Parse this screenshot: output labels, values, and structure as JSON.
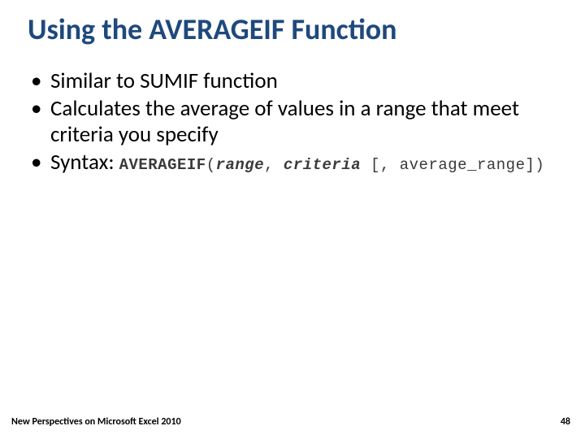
{
  "title": "Using the AVERAGEIF Function",
  "bullets": {
    "b1": "Similar to SUMIF function",
    "b2": "Calculates the average of values in a range that meet criteria you specify",
    "b3_label": "Syntax:"
  },
  "syntax": {
    "fn": "AVERAGEIF",
    "open": "(",
    "arg1": "range",
    "comma1": ", ",
    "arg2": "criteria",
    "opt_open": " [, ",
    "arg3": "average_range",
    "opt_close": "]",
    "close": ")"
  },
  "footer": {
    "left": "New Perspectives on Microsoft Excel 2010",
    "page": "48"
  },
  "marker": "•"
}
